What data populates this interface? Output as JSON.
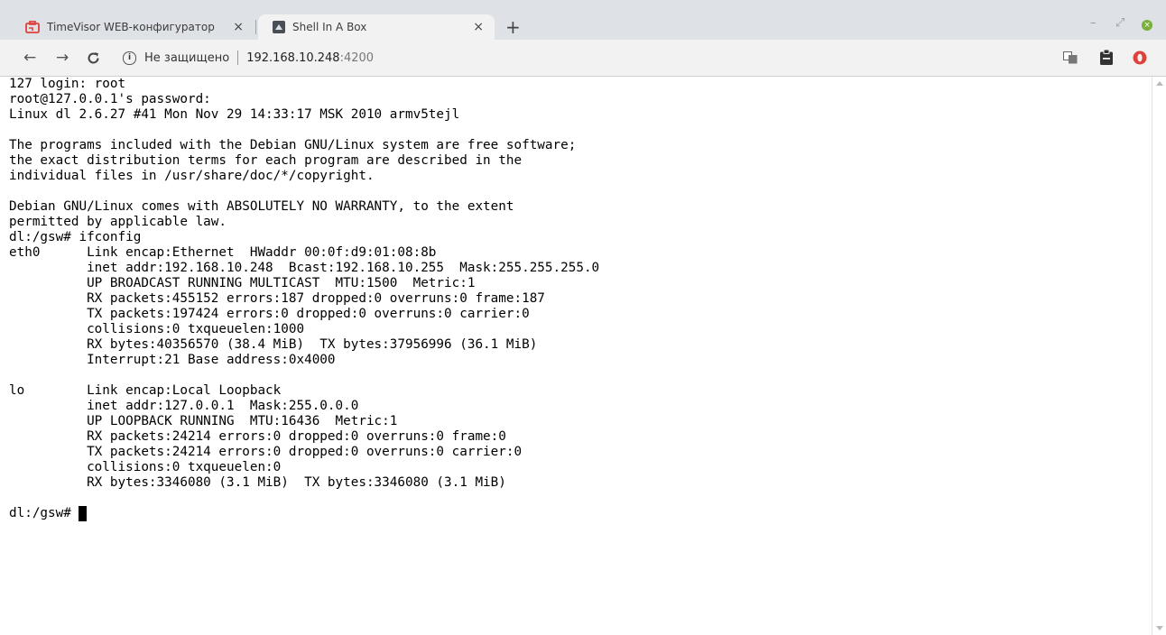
{
  "tabs": [
    {
      "title": "TimeVisor WEB-конфигуратор",
      "close": "×",
      "icon": "timevisor-logo-icon"
    },
    {
      "title": "Shell In A Box",
      "close": "×",
      "icon": "shellinabox-icon"
    }
  ],
  "new_tab": "+",
  "window_controls": {
    "minimize": "–",
    "maximize": "⤢",
    "close": "×"
  },
  "address_bar": {
    "security_icon": "i",
    "security_text": "Не защищено",
    "host": "192.168.10.248",
    "port": ":4200"
  },
  "colors": {
    "tab_strip": "#dee1e6",
    "toolbar": "#f2f2f2",
    "accent_red": "#e0403a",
    "window_close": "#78b03a"
  },
  "terminal": {
    "lines": [
      "127 login: root",
      "root@127.0.0.1's password:",
      "Linux dl 2.6.27 #41 Mon Nov 29 14:33:17 MSK 2010 armv5tejl",
      "",
      "The programs included with the Debian GNU/Linux system are free software;",
      "the exact distribution terms for each program are described in the",
      "individual files in /usr/share/doc/*/copyright.",
      "",
      "Debian GNU/Linux comes with ABSOLUTELY NO WARRANTY, to the extent",
      "permitted by applicable law.",
      "dl:/gsw# ifconfig",
      "eth0      Link encap:Ethernet  HWaddr 00:0f:d9:01:08:8b",
      "          inet addr:192.168.10.248  Bcast:192.168.10.255  Mask:255.255.255.0",
      "          UP BROADCAST RUNNING MULTICAST  MTU:1500  Metric:1",
      "          RX packets:455152 errors:187 dropped:0 overruns:0 frame:187",
      "          TX packets:197424 errors:0 dropped:0 overruns:0 carrier:0",
      "          collisions:0 txqueuelen:1000",
      "          RX bytes:40356570 (38.4 MiB)  TX bytes:37956996 (36.1 MiB)",
      "          Interrupt:21 Base address:0x4000",
      "",
      "lo        Link encap:Local Loopback",
      "          inet addr:127.0.0.1  Mask:255.0.0.0",
      "          UP LOOPBACK RUNNING  MTU:16436  Metric:1",
      "          RX packets:24214 errors:0 dropped:0 overruns:0 frame:0",
      "          TX packets:24214 errors:0 dropped:0 overruns:0 carrier:0",
      "          collisions:0 txqueuelen:0",
      "          RX bytes:3346080 (3.1 MiB)  TX bytes:3346080 (3.1 MiB)",
      ""
    ],
    "prompt": "dl:/gsw# "
  }
}
